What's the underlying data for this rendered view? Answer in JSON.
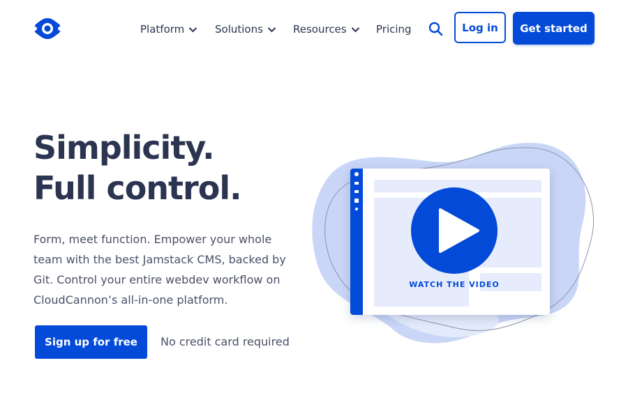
{
  "header": {
    "logo_name": "cloudcannon-logo",
    "nav": [
      {
        "label": "Platform",
        "has_dropdown": true
      },
      {
        "label": "Solutions",
        "has_dropdown": true
      },
      {
        "label": "Resources",
        "has_dropdown": true
      },
      {
        "label": "Pricing",
        "has_dropdown": false
      }
    ],
    "search_icon": "search-icon",
    "login_label": "Log in",
    "get_started_label": "Get started"
  },
  "hero": {
    "headline_line1": "Simplicity.",
    "headline_line2": "Full control.",
    "sub_lines": [
      "Form, meet function. Empower your whole",
      "team with the best Jamstack CMS, backed by",
      "Git. Control your entire webdev workflow on",
      "CloudCannon’s all-in-one platform."
    ],
    "signup_label": "Sign up for free",
    "no_credit_card": "No credit card required"
  },
  "video": {
    "watch_label": "WATCH THE VIDEO",
    "play_icon": "play-icon"
  },
  "colors": {
    "primary": "#034ad8",
    "heading": "#2b3450",
    "body_text": "#4a5068",
    "blob": "#c9d6f7",
    "blob_light": "#e3eafb"
  }
}
